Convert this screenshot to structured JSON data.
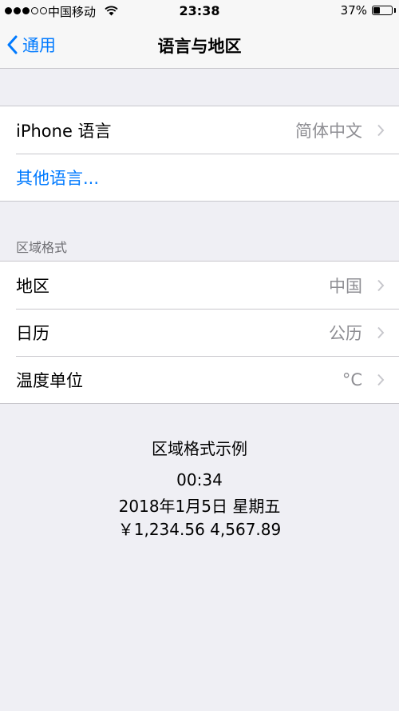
{
  "status_bar": {
    "carrier": "中国移动",
    "time": "23:38",
    "battery_percent": "37%",
    "battery_level": 0.37,
    "signal_bars": 3,
    "signal_max": 5
  },
  "nav": {
    "back_label": "通用",
    "title": "语言与地区",
    "back_icon": "chevron-left-icon"
  },
  "language_group": {
    "iphone_language_label": "iPhone 语言",
    "iphone_language_value": "简体中文",
    "other_languages_label": "其他语言..."
  },
  "region_format": {
    "section_header": "区域格式",
    "rows": [
      {
        "label": "地区",
        "value": "中国"
      },
      {
        "label": "日历",
        "value": "公历"
      },
      {
        "label": "温度单位",
        "value": "°C"
      }
    ]
  },
  "example": {
    "title": "区域格式示例",
    "time": "00:34",
    "date": "2018年1月5日 星期五",
    "numbers": "￥1,234.56  4,567.89"
  },
  "colors": {
    "accent": "#007aff",
    "background": "#efeff4",
    "secondary_text": "#8e8e93"
  }
}
